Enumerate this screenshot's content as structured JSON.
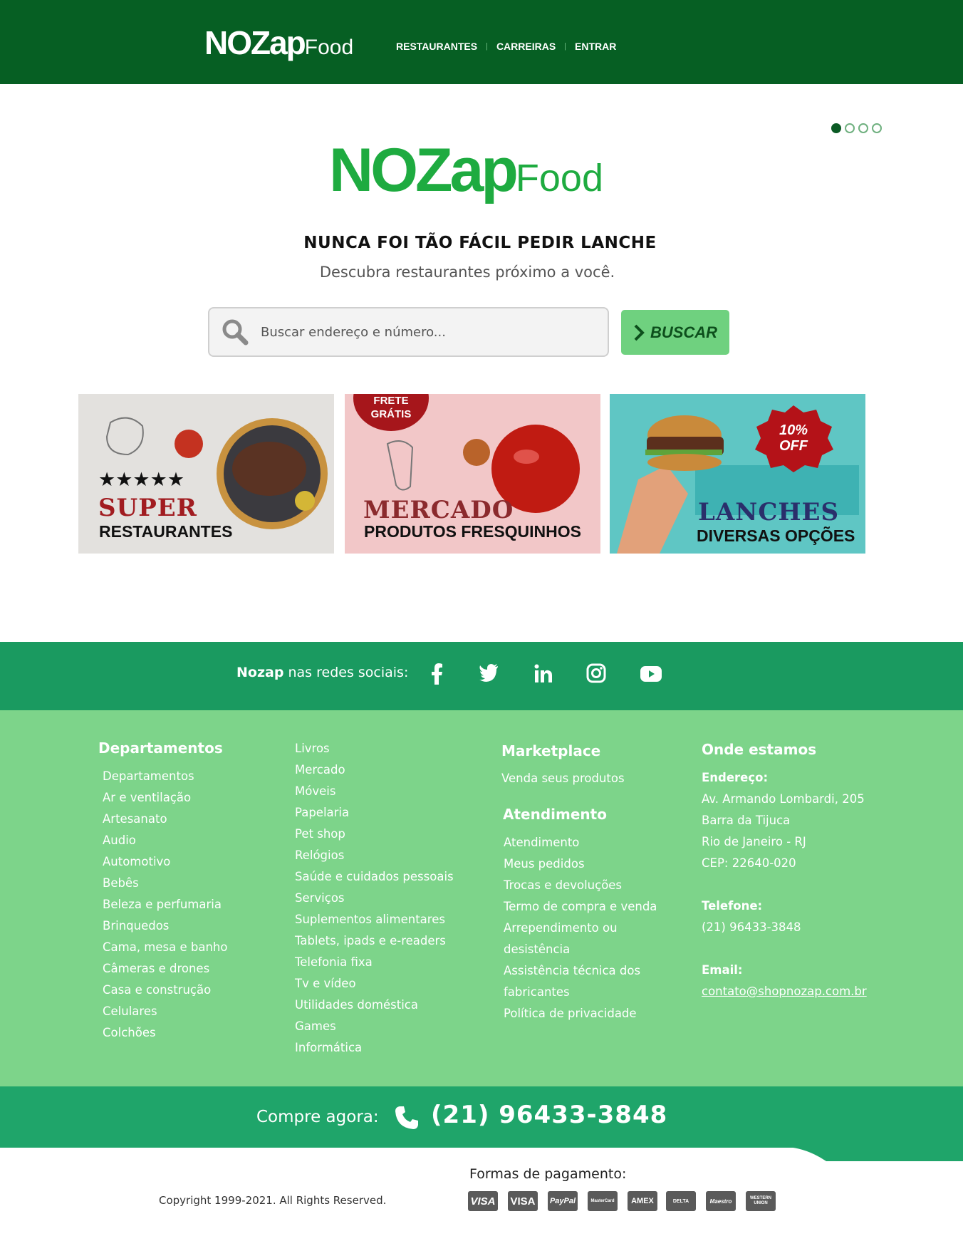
{
  "header": {
    "logo_bold": "NOZap",
    "logo_light": "Food",
    "nav": [
      "RESTAURANTES",
      "CARREIRAS",
      "ENTRAR"
    ]
  },
  "hero": {
    "logo_bold": "NOZap",
    "logo_light": "Food",
    "headline": "NUNCA FOI TÃO FÁCIL PEDIR LANCHE",
    "subtitle": "Descubra restaurantes próximo a você.",
    "search_placeholder": "Buscar endereço e número...",
    "search_button": "BUSCAR",
    "carousel_active": 1,
    "carousel_total": 4
  },
  "cards": [
    {
      "title": "SUPER",
      "subtitle": "RESTAURANTES",
      "stars": 5
    },
    {
      "badge": "FRETE GRÁTIS",
      "title": "MERCADO",
      "subtitle": "PRODUTOS FRESQUINHOS"
    },
    {
      "badge": "10% OFF",
      "title": "LANCHES",
      "subtitle": "DIVERSAS OPÇÕES"
    }
  ],
  "social": {
    "brand": "Nozap",
    "label": "nas redes sociais:",
    "icons": [
      "facebook-icon",
      "twitter-icon",
      "linkedin-icon",
      "instagram-icon",
      "youtube-icon"
    ]
  },
  "footer": {
    "departments_title": "Departamentos",
    "departments_col1": [
      "Departamentos",
      "Ar e ventilação",
      "Artesanato",
      "Audio",
      "Automotivo",
      "Bebês",
      "Beleza e perfumaria",
      "Brinquedos",
      "Cama, mesa e banho",
      "Câmeras e drones",
      "Casa e construção",
      "Celulares",
      "Colchões"
    ],
    "departments_col2": [
      "Livros",
      "Mercado",
      "Móveis",
      "Papelaria",
      "Pet shop",
      "Relógios",
      "Saúde e cuidados pessoais",
      "Serviços",
      "Suplementos alimentares",
      "Tablets, ipads e e-readers",
      "Telefonia fixa",
      "Tv e vídeo",
      "Utilidades doméstica",
      "Games",
      "Informática"
    ],
    "marketplace_title": "Marketplace",
    "marketplace_items": [
      "Venda seus produtos"
    ],
    "atendimento_title": "Atendimento",
    "atendimento_items": [
      "Atendimento",
      "Meus pedidos",
      "Trocas e devoluções",
      "Termo de compra e venda",
      "Arrependimento ou",
      "desistência",
      "Assistência técnica dos",
      "fabricantes",
      "Política de privacidade"
    ],
    "location_title": "Onde estamos",
    "address_label": "Endereço:",
    "address_lines": [
      "Av. Armando Lombardi, 205",
      "Barra da Tijuca",
      "Rio de Janeiro - RJ",
      "CEP: 22640-020"
    ],
    "phone_label": "Telefone:",
    "phone": "(21) 96433-3848",
    "email_label": "Email:",
    "email": "contato@shopnozap.com.br"
  },
  "cta": {
    "label": "Compre agora:",
    "phone": "(21) 96433-3848"
  },
  "bottom": {
    "copyright": "Copyright 1999-2021. All Rights Reserved.",
    "payment_label": "Formas de pagamento:",
    "payments": [
      "VISA",
      "VISA",
      "PayPal",
      "MasterCard",
      "AMEX",
      "DELTA",
      "Maestro",
      "WESTERN UNION"
    ]
  },
  "colors": {
    "header_bg": "#065f23",
    "brand_green": "#1eab40",
    "social_bg": "#1a9a60",
    "footer_bg": "#7dd48a",
    "cta_bg": "#1fa56a",
    "button_bg": "#6fd17f"
  }
}
